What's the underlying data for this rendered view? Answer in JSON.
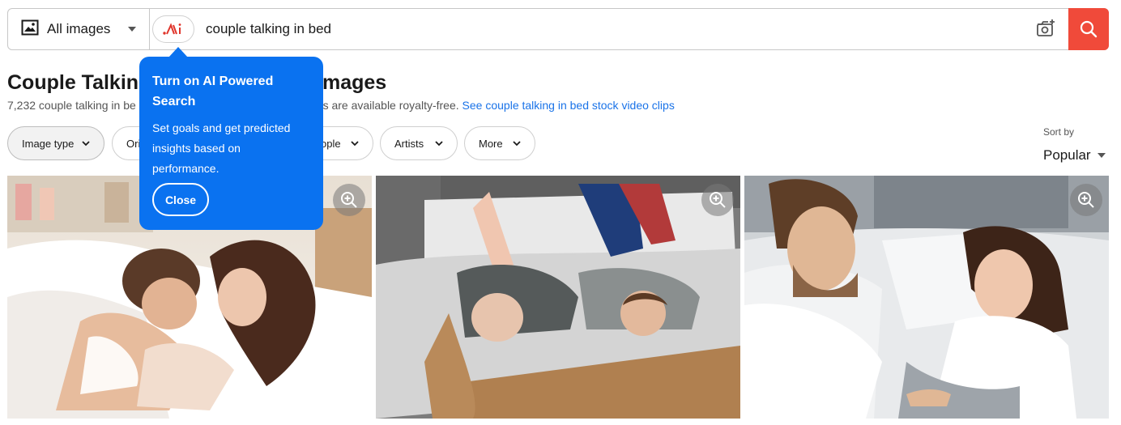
{
  "search": {
    "type_label": "All images",
    "ai_logo": "AI powered search logo",
    "query": "couple talking in bed",
    "camera_icon": "camera-plus-icon",
    "search_icon": "search-icon"
  },
  "heading": {
    "title_start": "Couple Talking",
    "title_end": "mages",
    "results_start": "7,232 couple talking in be",
    "results_end": "tions are available royalty-free.",
    "video_link": "See couple talking in bed stock video clips"
  },
  "filters": [
    {
      "label": "Image type"
    },
    {
      "label": "Ori"
    },
    {
      "label": "ople"
    },
    {
      "label": "Artists"
    },
    {
      "label": "More"
    }
  ],
  "sort": {
    "label": "Sort by",
    "value": "Popular"
  },
  "popover": {
    "title": "Turn on AI Powered Search",
    "body": "Set goals and get predicted insights based on performance.",
    "close_label": "Close"
  },
  "colors": {
    "search_button": "#f04a3a",
    "popover_bg": "#0a72f0",
    "link": "#1a73e8"
  },
  "images": [
    {
      "zoom_icon": "zoom-in-icon"
    },
    {
      "zoom_icon": "zoom-in-icon"
    },
    {
      "zoom_icon": "zoom-in-icon"
    }
  ]
}
